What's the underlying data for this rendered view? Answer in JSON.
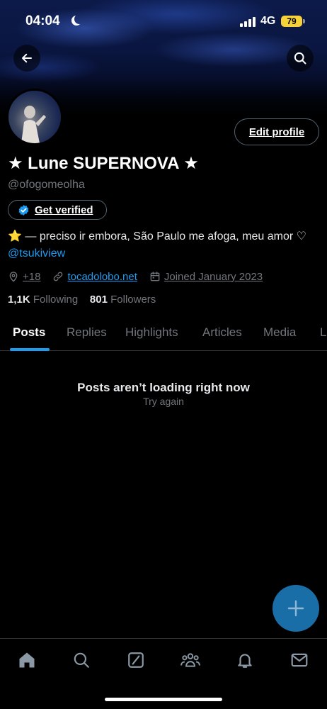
{
  "status_bar": {
    "time": "04:04",
    "network": "4G",
    "battery": "79"
  },
  "profile": {
    "display_name": "★ Lune SUPERNOVA ★",
    "handle": "@ofogomeolha",
    "edit_label": "Edit profile",
    "verify_label": "Get verified",
    "bio_text": "⭐ — preciso ir embora, São Paulo me afoga, meu amor ♡ ",
    "bio_mention": "@tsukiview",
    "location": "+18",
    "website": "tocadolobo.net",
    "joined": "Joined January 2023",
    "following_count": "1,1K",
    "following_label": "Following",
    "followers_count": "801",
    "followers_label": "Followers"
  },
  "tabs": [
    {
      "label": "Posts"
    },
    {
      "label": "Replies"
    },
    {
      "label": "Highlights"
    },
    {
      "label": "Articles"
    },
    {
      "label": "Media"
    },
    {
      "label": "L"
    }
  ],
  "feed": {
    "empty_title": "Posts aren’t loading right now",
    "retry_label": "Try again"
  },
  "icons": {
    "back": "back-arrow-icon",
    "search": "search-icon",
    "location": "location-pin-icon",
    "link": "link-icon",
    "calendar": "calendar-icon",
    "verified": "verified-badge-icon",
    "compose": "plus-icon",
    "nav": [
      "home-icon",
      "search-icon",
      "grok-icon",
      "communities-icon",
      "bell-icon",
      "mail-icon"
    ]
  },
  "colors": {
    "accent": "#1d9bf0",
    "muted": "#71767b",
    "battery": "#f7d13a",
    "fab": "#1a6ea8"
  }
}
